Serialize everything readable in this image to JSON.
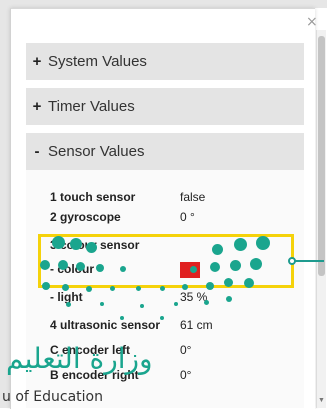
{
  "window": {
    "close_glyph": "×"
  },
  "sections": [
    {
      "symbol": "+",
      "label": "System Values"
    },
    {
      "symbol": "+",
      "label": "Timer Values"
    },
    {
      "symbol": "-",
      "label": "Sensor Values"
    }
  ],
  "sensors": [
    {
      "name": "1 touch sensor",
      "value": "false"
    },
    {
      "name": "2 gyroscope",
      "value": "0 °"
    },
    {
      "name": "3 colour sensor",
      "value": ""
    },
    {
      "name": "- colour",
      "value": "",
      "swatch_color": "#e02020"
    },
    {
      "name": "- light",
      "value": "35 %"
    },
    {
      "name": "4 ultrasonic sensor",
      "value": "61 cm"
    },
    {
      "name": "C encoder left",
      "value": "0°"
    },
    {
      "name": "B encoder right",
      "value": "0°"
    }
  ],
  "watermark": {
    "arabic": "وزارة التعليم",
    "latin": "u of Education"
  },
  "colors": {
    "highlight": "#f5d20a",
    "accent": "#1aa58e",
    "callout": "#1e9b8f"
  }
}
